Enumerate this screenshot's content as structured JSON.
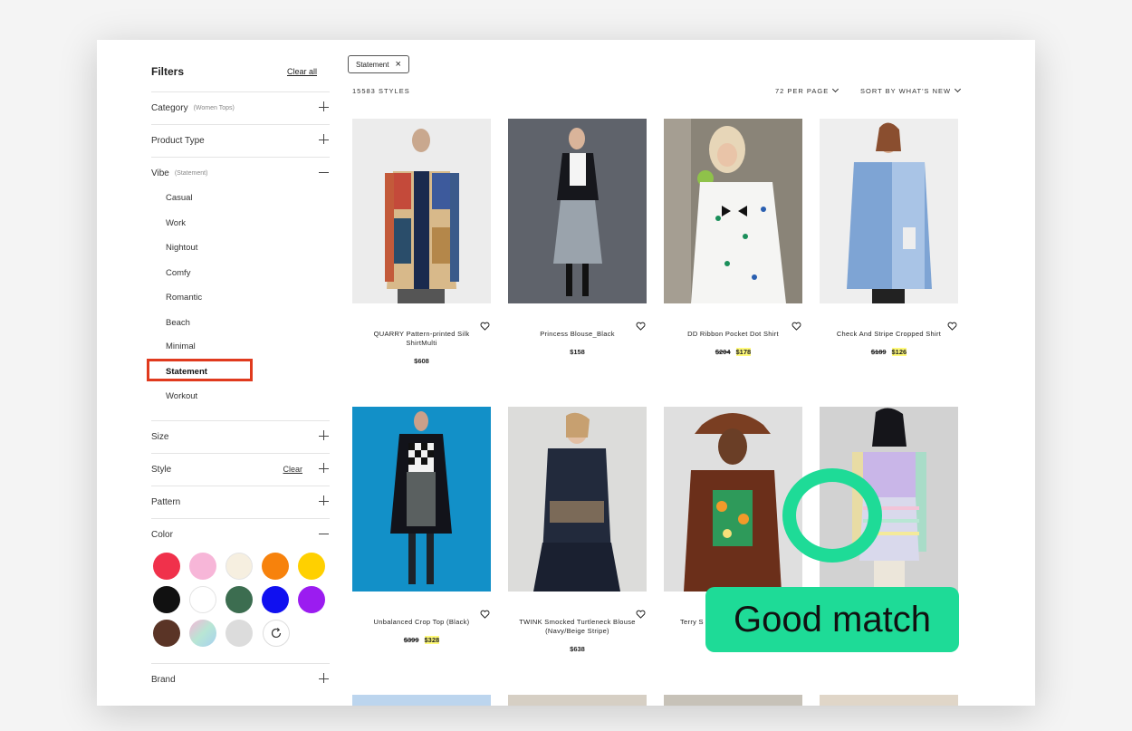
{
  "sidebar": {
    "title": "Filters",
    "clear_all": "Clear all",
    "sections": {
      "category": {
        "label": "Category",
        "note": "(Women Tops)"
      },
      "product_type": {
        "label": "Product Type"
      },
      "vibe": {
        "label": "Vibe",
        "note": "(Statement)"
      },
      "size": {
        "label": "Size"
      },
      "style": {
        "label": "Style",
        "clear": "Clear"
      },
      "pattern": {
        "label": "Pattern"
      },
      "color": {
        "label": "Color"
      },
      "brand": {
        "label": "Brand"
      }
    },
    "vibe_options": [
      "Casual",
      "Work",
      "Nightout",
      "Comfy",
      "Romantic",
      "Beach",
      "Minimal",
      "Statement",
      "Workout"
    ],
    "selected_vibe": "Statement",
    "colors": [
      "#f0314b",
      "#f7b6d8",
      "#f6efe0",
      "#f7820c",
      "#ffd000",
      "#111111",
      "#ffffff",
      "#3c6d50",
      "#1010f0",
      "#9b1cf0",
      "#5a3426",
      "#b8e6d4",
      "#dcdcdc"
    ]
  },
  "main": {
    "active_chip": "Statement",
    "styles_count": "15583 STYLES",
    "per_page": "72 PER PAGE",
    "sort_by": "SORT BY WHAT'S NEW"
  },
  "products": [
    {
      "name": "QUARRY Pattern-printed Silk ShirtMulti",
      "price": "$608"
    },
    {
      "name": "Princess Blouse_Black",
      "price": "$158"
    },
    {
      "name": "DD Ribbon Pocket Dot Shirt",
      "orig": "$204",
      "sale": "$178"
    },
    {
      "name": "Check And Stripe Cropped Shirt",
      "orig": "$189",
      "sale": "$126"
    },
    {
      "name": "Unbalanced Crop Top (Black)",
      "orig": "$399",
      "sale": "$328"
    },
    {
      "name": "TWINK Smocked Turtleneck Blouse (Navy/Beige Stripe)",
      "price": "$638"
    },
    {
      "name": "Terry S"
    }
  ],
  "overlay": {
    "label": "Good match",
    "accent": "#1edb97",
    "highlight": "#e03a1e"
  }
}
